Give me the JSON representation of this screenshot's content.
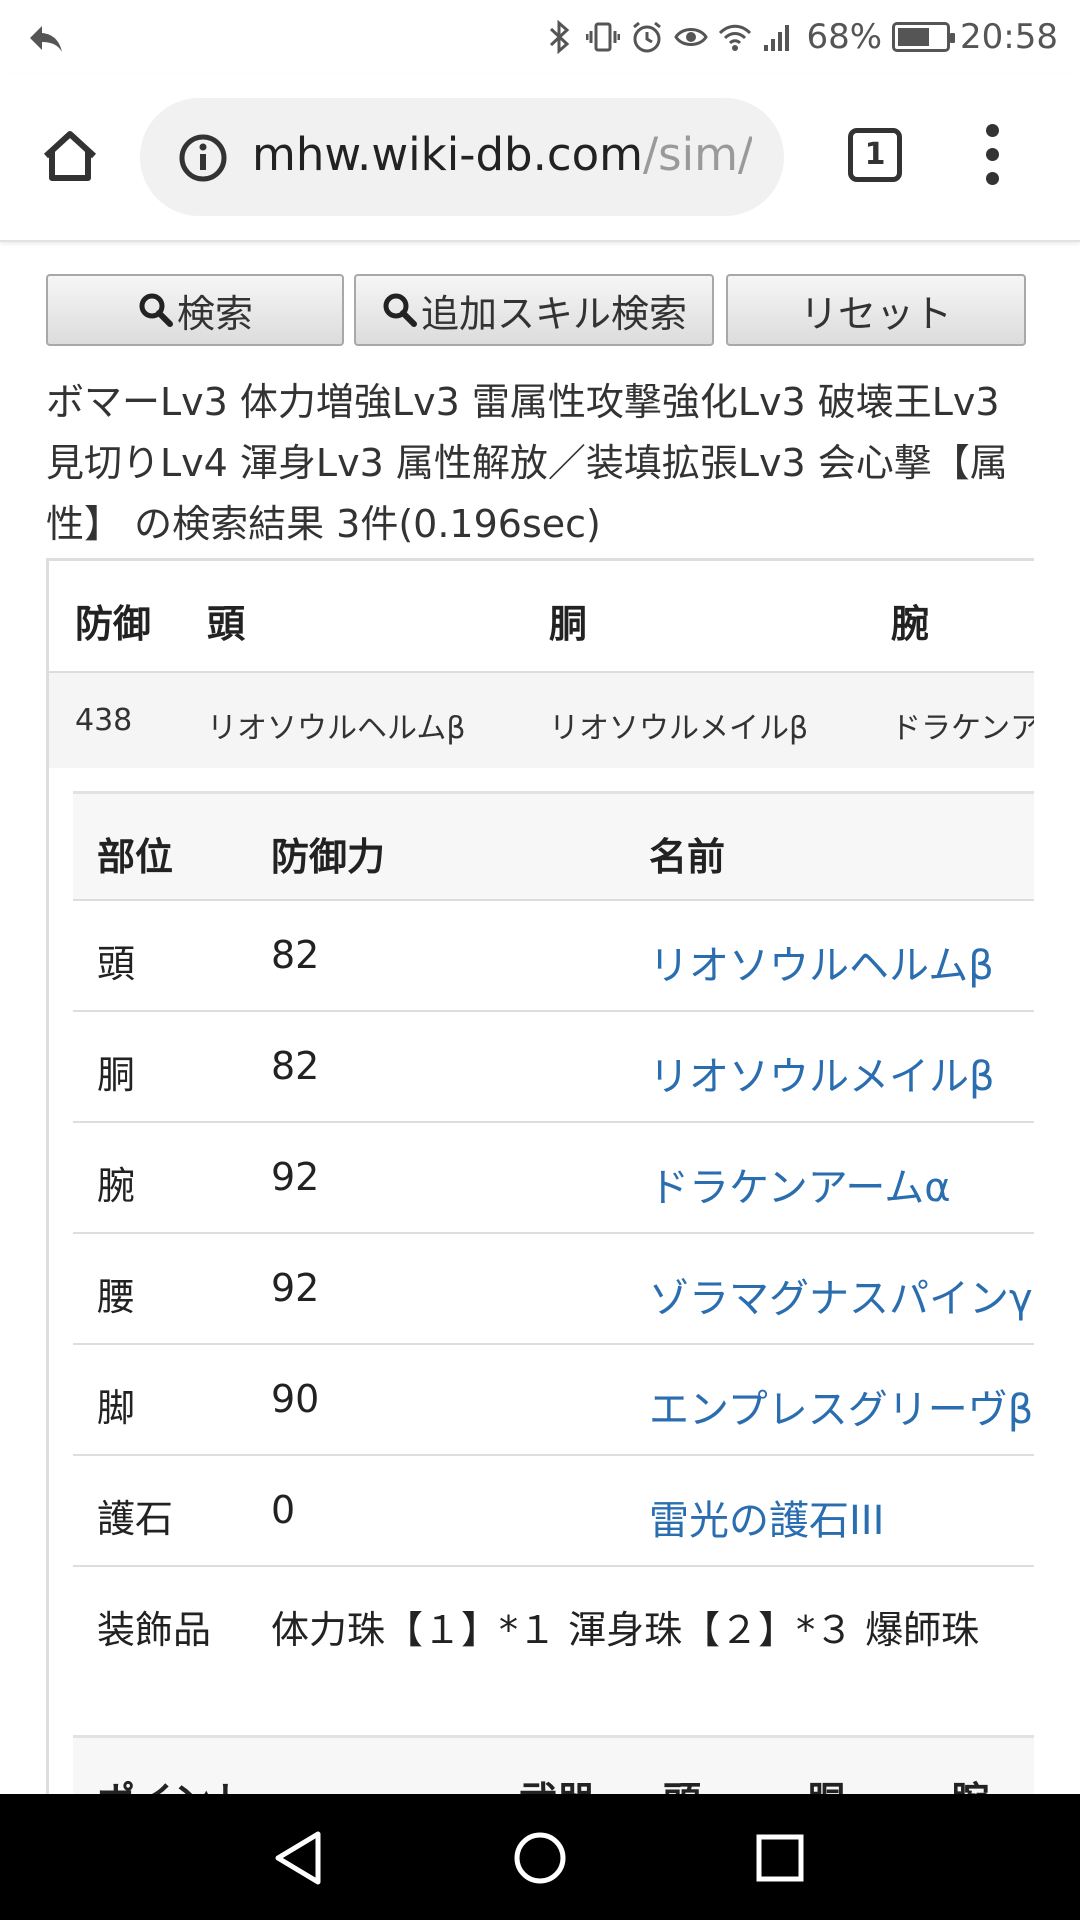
{
  "status": {
    "battery": "68%",
    "battery_level": 0.68,
    "time": "20:58"
  },
  "browser": {
    "url_host": "mhw.wiki-db.com",
    "url_path": "/sim/#",
    "tab_count": "1"
  },
  "buttons": {
    "search": "検索",
    "add_skill_search": "追加スキル検索",
    "reset": "リセット"
  },
  "result_text": "ボマーLv3 体力増強Lv3 雷属性攻撃強化Lv3 破壊王Lv3 見切りLv4 渾身Lv3 属性解放／装填拡張Lv3 会心撃【属性】 の検索結果 3件(0.196sec)",
  "summary": {
    "headers": [
      "防御",
      "頭",
      "胴",
      "腕"
    ],
    "row": [
      "438",
      "リオソウルヘルムβ",
      "リオソウルメイルβ",
      "ドラケンア"
    ]
  },
  "detail": {
    "headers": [
      "部位",
      "防御力",
      "名前"
    ],
    "rows": [
      {
        "part": "頭",
        "defense": "82",
        "name": "リオソウルヘルムβ"
      },
      {
        "part": "胴",
        "defense": "82",
        "name": "リオソウルメイルβ"
      },
      {
        "part": "腕",
        "defense": "92",
        "name": "ドラケンアームα"
      },
      {
        "part": "腰",
        "defense": "92",
        "name": "ゾラマグナスパインγ"
      },
      {
        "part": "脚",
        "defense": "90",
        "name": "エンプレスグリーヴβ"
      },
      {
        "part": "護石",
        "defense": "0",
        "name": "雷光の護石III"
      }
    ],
    "decorations_label": "装飾品",
    "decorations_value": "体力珠【１】*１ 渾身珠【２】*３ 爆師珠"
  },
  "points_headers": [
    "ポイント",
    "武器",
    "頭",
    "胴",
    "腕"
  ]
}
